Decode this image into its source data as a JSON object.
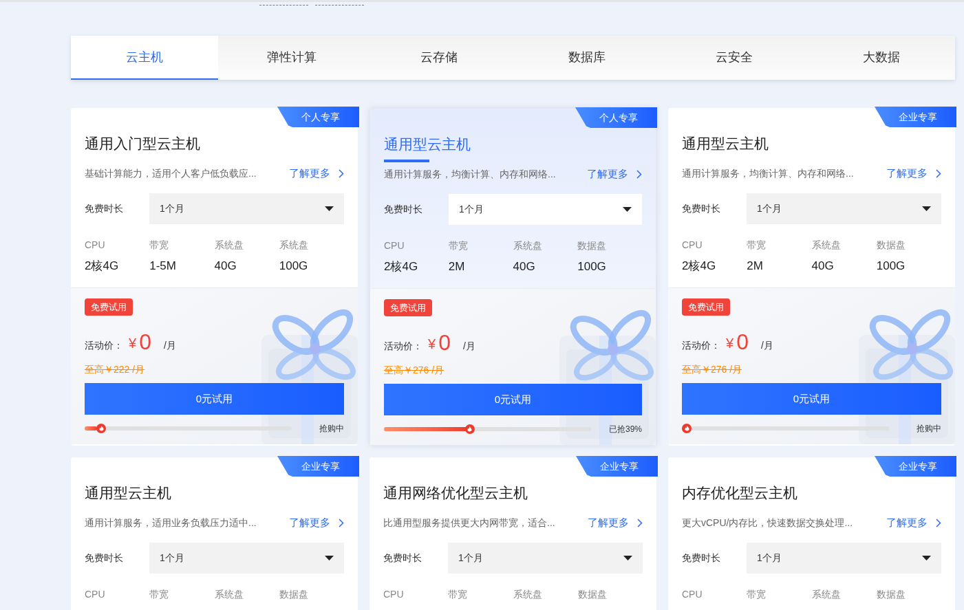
{
  "tabs": [
    {
      "label": "云主机",
      "selected": true
    },
    {
      "label": "弹性计算",
      "selected": false
    },
    {
      "label": "云存储",
      "selected": false
    },
    {
      "label": "数据库",
      "selected": false
    },
    {
      "label": "云安全",
      "selected": false
    },
    {
      "label": "大数据",
      "selected": false
    }
  ],
  "cards": [
    {
      "badge": "个人专享",
      "title": "通用入门型云主机",
      "highlighted": false,
      "description": "基础计算能力，适用个人客户低负载应...",
      "link": "了解更多",
      "duration_label": "免费时长",
      "duration": "1个月",
      "specs": [
        {
          "label": "CPU",
          "value": "2核4G"
        },
        {
          "label": "带宽",
          "value": "1-5M"
        },
        {
          "label": "系统盘",
          "value": "40G"
        },
        {
          "label": "系统盘",
          "value": "100G"
        }
      ],
      "offer": {
        "tag": "免费试用",
        "price_label": "活动价：",
        "currency": "¥",
        "price": "0",
        "unit": "/月",
        "original_price": "至高￥222 /月",
        "button": "0元试用",
        "level": 0.06,
        "progress_label": "抢购中"
      }
    },
    {
      "badge": "个人专享",
      "title": "通用型云主机",
      "highlighted": true,
      "description": "通用计算服务，均衡计算、内存和网络...",
      "link": "了解更多",
      "duration_label": "免费时长",
      "duration": "1个月",
      "specs": [
        {
          "label": "CPU",
          "value": "2核4G"
        },
        {
          "label": "带宽",
          "value": "2M"
        },
        {
          "label": "系统盘",
          "value": "40G"
        },
        {
          "label": "数据盘",
          "value": "100G"
        }
      ],
      "offer": {
        "tag": "免费试用",
        "price_label": "活动价：",
        "currency": "¥",
        "price": "0",
        "unit": "/月",
        "original_price": "至高￥276 /月",
        "button": "0元试用",
        "level": 0.41,
        "progress_label": "已抢39%"
      }
    },
    {
      "badge": "企业专享",
      "title": "通用型云主机",
      "highlighted": false,
      "description": "通用计算服务，均衡计算、内存和网络...",
      "link": "了解更多",
      "duration_label": "免费时长",
      "duration": "1个月",
      "specs": [
        {
          "label": "CPU",
          "value": "2核4G"
        },
        {
          "label": "带宽",
          "value": "2M"
        },
        {
          "label": "系统盘",
          "value": "40G"
        },
        {
          "label": "数据盘",
          "value": "100G"
        }
      ],
      "offer": {
        "tag": "免费试用",
        "price_label": "活动价：",
        "currency": "¥",
        "price": "0",
        "unit": "/月",
        "original_price": "至高￥276 /月",
        "button": "0元试用",
        "level": 0,
        "progress_label": "抢购中"
      }
    },
    {
      "badge": "企业专享",
      "title": "通用型云主机",
      "highlighted": false,
      "description": "通用计算服务，适用业务负载压力适中...",
      "link": "了解更多",
      "duration_label": "免费时长",
      "duration": "1个月",
      "specs": [
        {
          "label": "CPU"
        },
        {
          "label": "带宽"
        },
        {
          "label": "系统盘"
        },
        {
          "label": "数据盘"
        }
      ]
    },
    {
      "badge": "企业专享",
      "title": "通用网络优化型云主机",
      "highlighted": false,
      "description": "比通用型服务提供更大内网带宽，适合...",
      "link": "了解更多",
      "duration_label": "免费时长",
      "duration": "1个月",
      "specs": [
        {
          "label": "CPU"
        },
        {
          "label": "带宽"
        },
        {
          "label": "系统盘"
        },
        {
          "label": "数据盘"
        }
      ]
    },
    {
      "badge": "企业专享",
      "title": "内存优化型云主机",
      "highlighted": false,
      "description": "更大vCPU/内存比，快速数据交换处理...",
      "link": "了解更多",
      "duration_label": "免费时长",
      "duration": "1个月",
      "specs": [
        {
          "label": "CPU"
        },
        {
          "label": "带宽"
        },
        {
          "label": "系统盘"
        },
        {
          "label": "数据盘"
        }
      ]
    }
  ]
}
